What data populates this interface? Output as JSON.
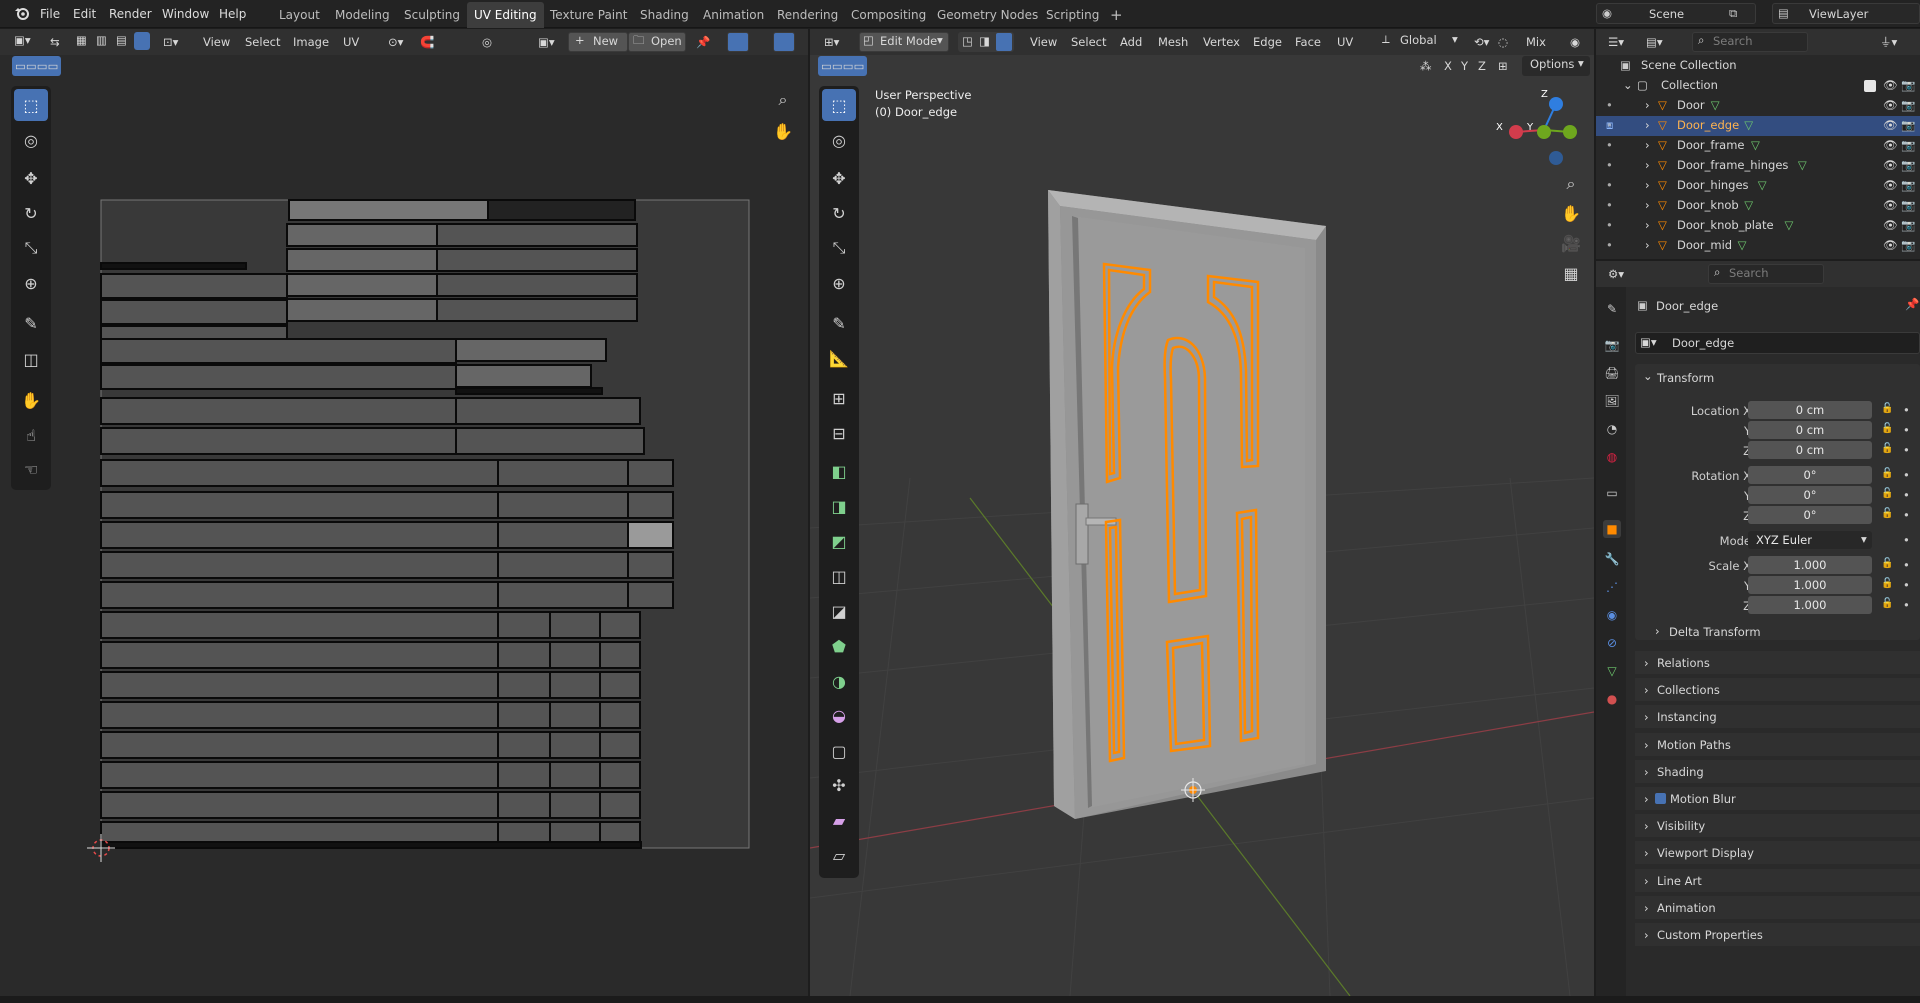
{
  "topbar": {
    "menus": [
      "File",
      "Edit",
      "Render",
      "Window",
      "Help"
    ],
    "workspaces": [
      "Layout",
      "Modeling",
      "Sculpting",
      "UV Editing",
      "Texture Paint",
      "Shading",
      "Animation",
      "Rendering",
      "Compositing",
      "Geometry Nodes",
      "Scripting"
    ],
    "add_tab": "+",
    "scene": "Scene",
    "view_layer": "ViewLayer"
  },
  "uv_editor": {
    "menus": [
      "View",
      "Select",
      "Image",
      "UV"
    ],
    "new_label": "New",
    "open_label": "Open"
  },
  "viewport": {
    "mode": "Edit Mode",
    "menus": [
      "View",
      "Select",
      "Add",
      "Mesh",
      "Vertex",
      "Edge",
      "Face",
      "UV"
    ],
    "orientation": "Global",
    "shading": "Mix",
    "options": "Options",
    "view_name": "User Perspective",
    "object_label": "(0) Door_edge",
    "gizmo": {
      "z": "Z",
      "y": "Y",
      "x": "X"
    },
    "axes": [
      "X",
      "Y",
      "Z"
    ]
  },
  "outliner": {
    "search_placeholder": "Search",
    "root": "Scene Collection",
    "collection": "Collection",
    "objects": [
      "Door",
      "Door_edge",
      "Door_frame",
      "Door_frame_hinges",
      "Door_hinges",
      "Door_knob",
      "Door_knob_plate",
      "Door_mid"
    ],
    "selected": "Door_edge"
  },
  "properties": {
    "search_placeholder": "Search",
    "object_name": "Door_edge",
    "object_name_field": "Door_edge",
    "transform_label": "Transform",
    "location": {
      "label_x": "Location X",
      "label_y": "Y",
      "label_z": "Z",
      "x": "0 cm",
      "y": "0 cm",
      "z": "0 cm"
    },
    "rotation": {
      "label_x": "Rotation X",
      "label_y": "Y",
      "label_z": "Z",
      "x": "0°",
      "y": "0°",
      "z": "0°"
    },
    "mode": {
      "label": "Mode",
      "value": "XYZ Euler"
    },
    "scale": {
      "label_x": "Scale X",
      "label_y": "Y",
      "label_z": "Z",
      "x": "1.000",
      "y": "1.000",
      "z": "1.000"
    },
    "delta": "Delta Transform",
    "panels": [
      "Relations",
      "Collections",
      "Instancing",
      "Motion Paths",
      "Shading",
      "Motion Blur",
      "Visibility",
      "Viewport Display",
      "Line Art",
      "Animation",
      "Custom Properties"
    ]
  },
  "colors": {
    "accent": "#4772b3",
    "selection": "#ff8a00",
    "x_axis": "#d23c4c",
    "y_axis": "#6ea71e",
    "z_axis": "#2f7ee0"
  }
}
